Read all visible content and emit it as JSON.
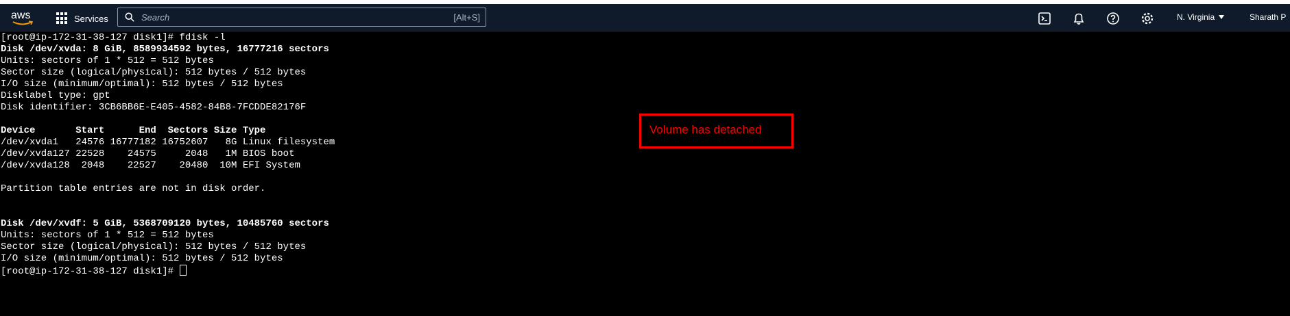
{
  "header": {
    "logo_text": "aws",
    "services_label": "Services",
    "search": {
      "placeholder": "Search",
      "shortcut": "[Alt+S]"
    },
    "icons": [
      "cloudshell-icon",
      "bell-icon",
      "help-icon",
      "gear-icon"
    ],
    "region_label": "N. Virginia",
    "user_label": "Sharath P"
  },
  "terminal": {
    "lines": [
      {
        "text": "[root@ip-172-31-38-127 disk1]# fdisk -l",
        "bold": false
      },
      {
        "text": "Disk /dev/xvda: 8 GiB, 8589934592 bytes, 16777216 sectors",
        "bold": true
      },
      {
        "text": "Units: sectors of 1 * 512 = 512 bytes",
        "bold": false
      },
      {
        "text": "Sector size (logical/physical): 512 bytes / 512 bytes",
        "bold": false
      },
      {
        "text": "I/O size (minimum/optimal): 512 bytes / 512 bytes",
        "bold": false
      },
      {
        "text": "Disklabel type: gpt",
        "bold": false
      },
      {
        "text": "Disk identifier: 3CB6BB6E-E405-4582-84B8-7FCDDE82176F",
        "bold": false
      },
      {
        "text": "",
        "bold": false
      },
      {
        "text": "Device       Start      End  Sectors Size Type",
        "bold": true
      },
      {
        "text": "/dev/xvda1   24576 16777182 16752607   8G Linux filesystem",
        "bold": false
      },
      {
        "text": "/dev/xvda127 22528    24575     2048   1M BIOS boot",
        "bold": false
      },
      {
        "text": "/dev/xvda128  2048    22527    20480  10M EFI System",
        "bold": false
      },
      {
        "text": "",
        "bold": false
      },
      {
        "text": "Partition table entries are not in disk order.",
        "bold": false
      },
      {
        "text": "",
        "bold": false
      },
      {
        "text": "",
        "bold": false
      },
      {
        "text": "Disk /dev/xvdf: 5 GiB, 5368709120 bytes, 10485760 sectors",
        "bold": true
      },
      {
        "text": "Units: sectors of 1 * 512 = 512 bytes",
        "bold": false
      },
      {
        "text": "Sector size (logical/physical): 512 bytes / 512 bytes",
        "bold": false
      },
      {
        "text": "I/O size (minimum/optimal): 512 bytes / 512 bytes",
        "bold": false
      }
    ],
    "prompt": "[root@ip-172-31-38-127 disk1]# "
  },
  "annotation": {
    "text": "Volume has detached",
    "color": "#ff0000"
  }
}
